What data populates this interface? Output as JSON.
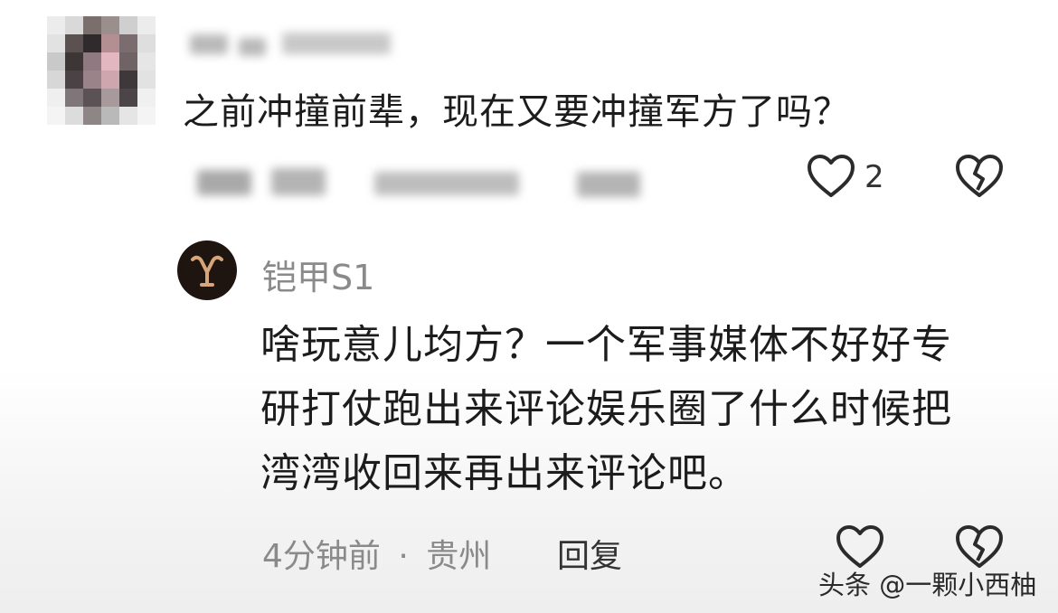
{
  "comment": {
    "username": "",
    "text": "之前冲撞前辈，现在又要冲撞军方了吗？",
    "like_count": "2"
  },
  "reply": {
    "username": "铠甲S1",
    "text_lines": [
      "啥玩意儿均方？一个军事媒体不好好专",
      "研打仗跑出来评论娱乐圈了什么时候把",
      "湾湾收回来再出来评论吧。"
    ],
    "time": "4分钟前",
    "separator": "·",
    "location": "贵州",
    "reply_label": "回复"
  },
  "watermark": "头条 @一颗小西柚",
  "colors": {
    "heart_stroke": "#2b2b2b",
    "meta_text": "#8a8a8a",
    "avatar_bg": "#1e1510",
    "avatar_logo": "#d7a57a"
  },
  "icons": [
    "like-heart-icon",
    "dislike-broken-heart-icon"
  ]
}
